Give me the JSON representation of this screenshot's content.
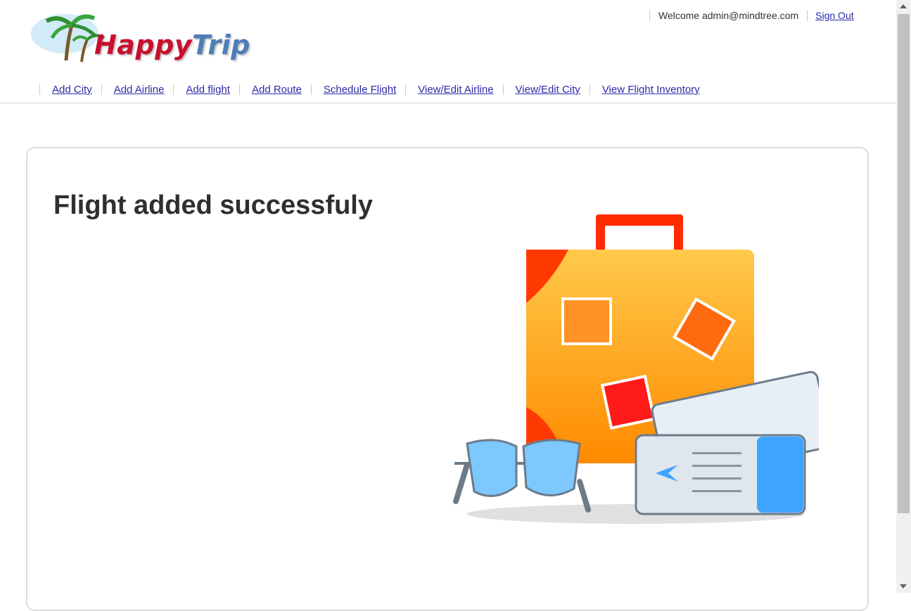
{
  "brand": {
    "part1": "Happy",
    "part2": "Trip"
  },
  "user": {
    "welcome": "Welcome admin@mindtree.com",
    "signout": "Sign Out"
  },
  "nav": {
    "items": [
      {
        "label": "Add City"
      },
      {
        "label": "Add Airline"
      },
      {
        "label": "Add flight"
      },
      {
        "label": "Add Route"
      },
      {
        "label": "Schedule Flight"
      },
      {
        "label": "View/Edit Airline"
      },
      {
        "label": "View/Edit City"
      },
      {
        "label": "View Flight Inventory"
      }
    ]
  },
  "main": {
    "message": "Flight added successfuly"
  },
  "colors": {
    "link": "#2a2aa8",
    "brand_red": "#c8102e",
    "brand_blue": "#4f7db8",
    "suitcase": "#ff9a1a"
  }
}
